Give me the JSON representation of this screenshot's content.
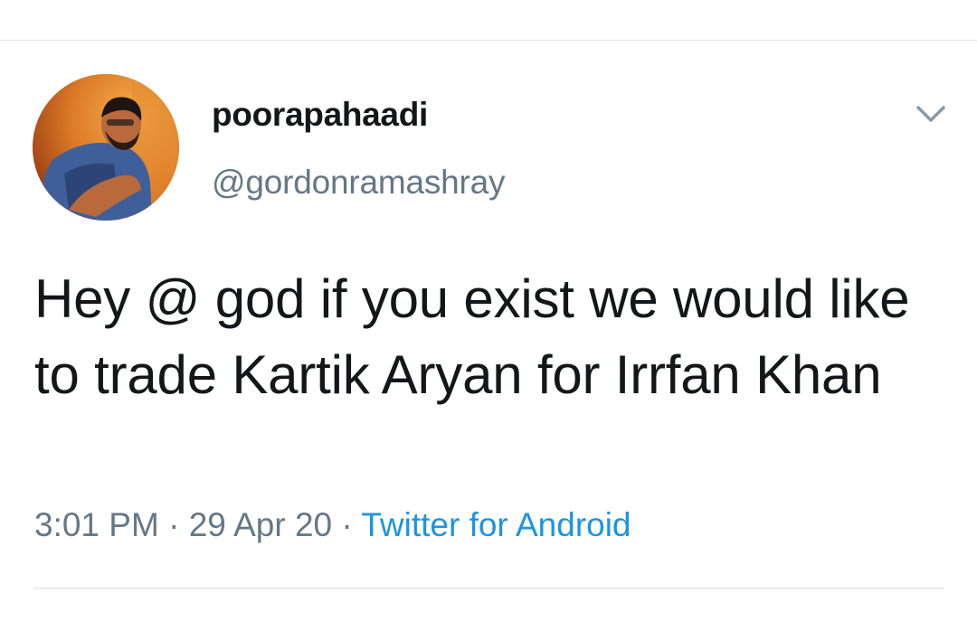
{
  "tweet": {
    "author": {
      "display_name": "poorapahaadi",
      "handle": "@gordonramashray",
      "avatar_icon": "user-avatar-photo"
    },
    "menu_icon": "chevron-down-icon",
    "text": "Hey @ god if you exist we would like to trade Kartik Aryan for Irrfan Khan",
    "time": "3:01 PM",
    "separator": "·",
    "date": "29 Apr 20",
    "source": "Twitter for Android"
  },
  "colors": {
    "text_primary": "#14171a",
    "text_secondary": "#657786",
    "link_blue": "#1b95e0",
    "divider": "#e1e8ed",
    "caret": "#8899a6"
  }
}
